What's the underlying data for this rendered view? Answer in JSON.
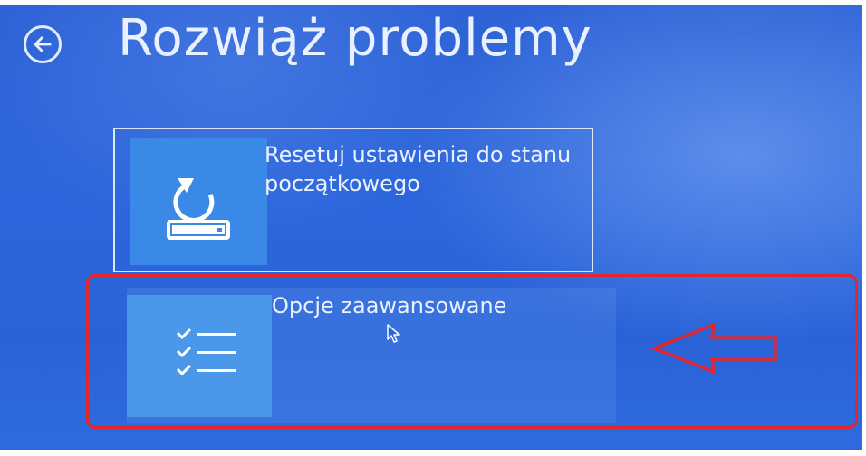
{
  "header": {
    "title": "Rozwiąż problemy",
    "back_icon": "back-arrow-icon"
  },
  "options": [
    {
      "label": "Resetuj ustawienia do stanu początkowego",
      "icon": "reset-pc-icon"
    },
    {
      "label": "Opcje zaawansowane",
      "icon": "checklist-icon",
      "highlighted": true
    }
  ],
  "annotation": {
    "arrow_icon": "red-left-arrow",
    "highlight_color": "#e3262e"
  },
  "colors": {
    "background": "#2d66dc",
    "tile_icon_background": "#3b89e6",
    "text": "#eaf1ff"
  }
}
